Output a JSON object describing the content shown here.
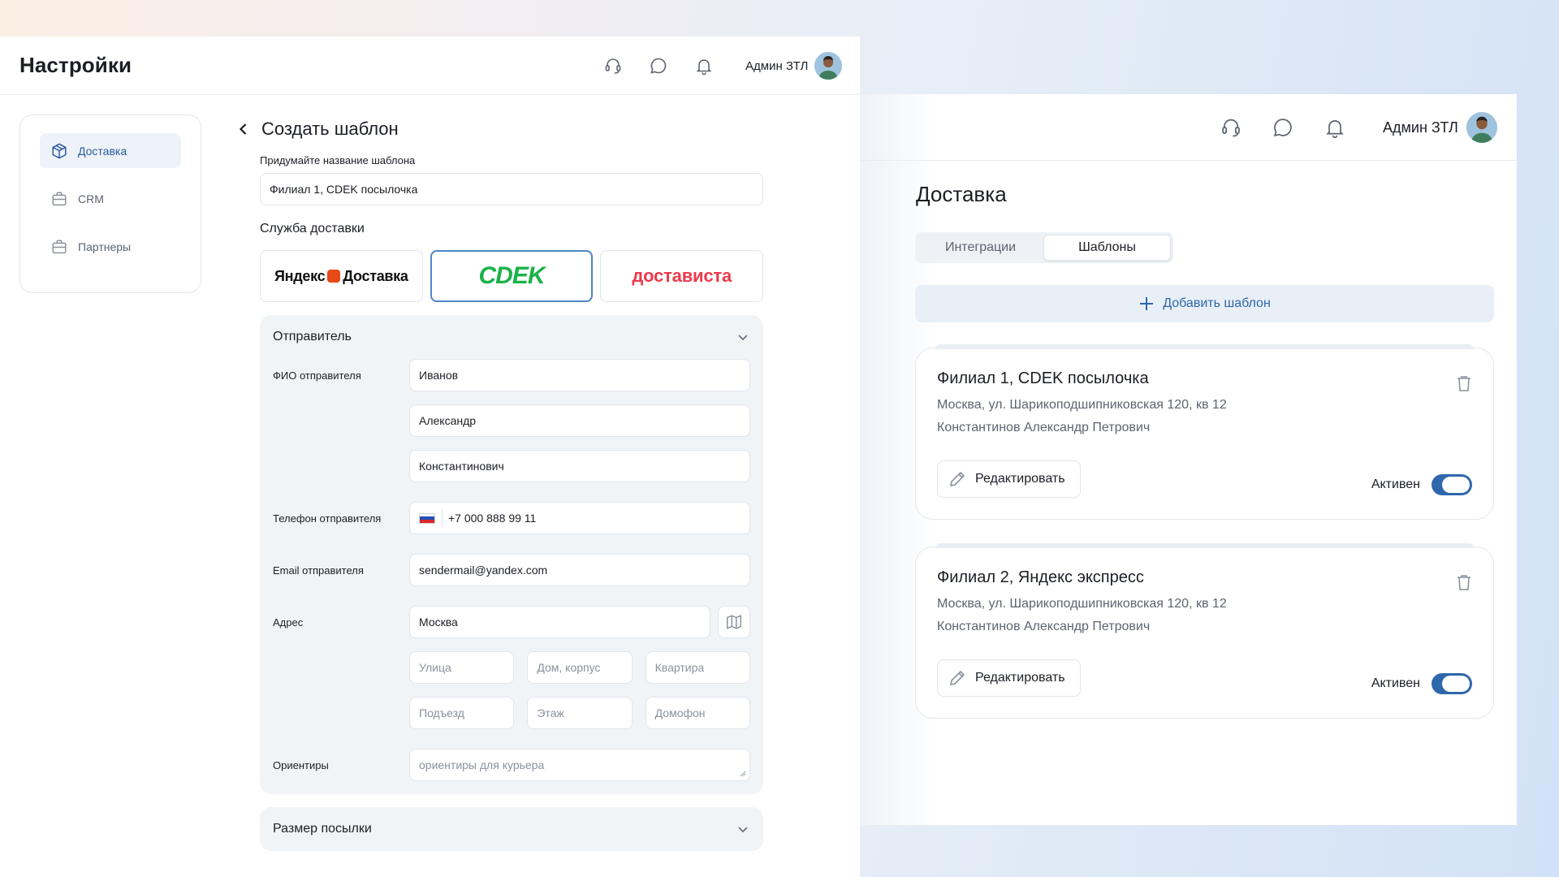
{
  "left": {
    "title": "Настройки",
    "user_name": "Админ ЗТЛ",
    "sidebar": [
      {
        "label": "Доставка",
        "icon": "box-icon"
      },
      {
        "label": "CRM",
        "icon": "briefcase-icon"
      },
      {
        "label": "Партнеры",
        "icon": "briefcase-icon"
      }
    ],
    "form": {
      "title": "Создать шаблон",
      "name_label": "Придумайте название шаблона",
      "name_value": "Филиал 1, CDEK посылочка",
      "service_label": "Служба доставки",
      "carriers": {
        "yandex_a": "Яндекс",
        "yandex_b": "Доставка",
        "cdek": "CDEK",
        "dostavista": "достависта"
      },
      "sender_title": "Отправитель",
      "fio_label": "ФИО отправителя",
      "last_name": "Иванов",
      "first_name": "Александр",
      "middle_name": "Константинович",
      "phone_label": "Телефон отправителя",
      "phone_value": "+7 000 888 99 11",
      "email_label": "Email отправителя",
      "email_value": "sendermail@yandex.com",
      "address_label": "Адрес",
      "city_value": "Москва",
      "street_ph": "Улица",
      "house_ph": "Дом, корпус",
      "apt_ph": "Квартира",
      "entrance_ph": "Подъезд",
      "floor_ph": "Этаж",
      "intercom_ph": "Домофон",
      "landmarks_label": "Ориентиры",
      "landmarks_ph": "ориентиры для курьера",
      "package_title": "Размер посылки"
    }
  },
  "right": {
    "user_name": "Админ ЗТЛ",
    "title": "Доставка",
    "tabs": [
      "Интеграции",
      "Шаблоны"
    ],
    "active_tab": "Шаблоны",
    "add_label": "Добавить шаблон",
    "templates": [
      {
        "title": "Филиал 1, CDEK посылочка",
        "address": "Москва, ул. Шарикоподшипниковская 120, кв 12",
        "person": "Константинов Александр Петрович",
        "edit_label": "Редактировать",
        "status_label": "Активен",
        "active": true
      },
      {
        "title": "Филиал 2, Яндекс экспресс",
        "address": "Москва, ул. Шарикоподшипниковская 120, кв 12",
        "person": "Константинов Александр Петрович",
        "edit_label": "Редактировать",
        "status_label": "Активен",
        "active": true
      }
    ]
  },
  "colors": {
    "accent": "#2f67ac",
    "cdek": "#1ab248",
    "dostavista": "#ee3a4a",
    "yandex": "#e64a19"
  }
}
